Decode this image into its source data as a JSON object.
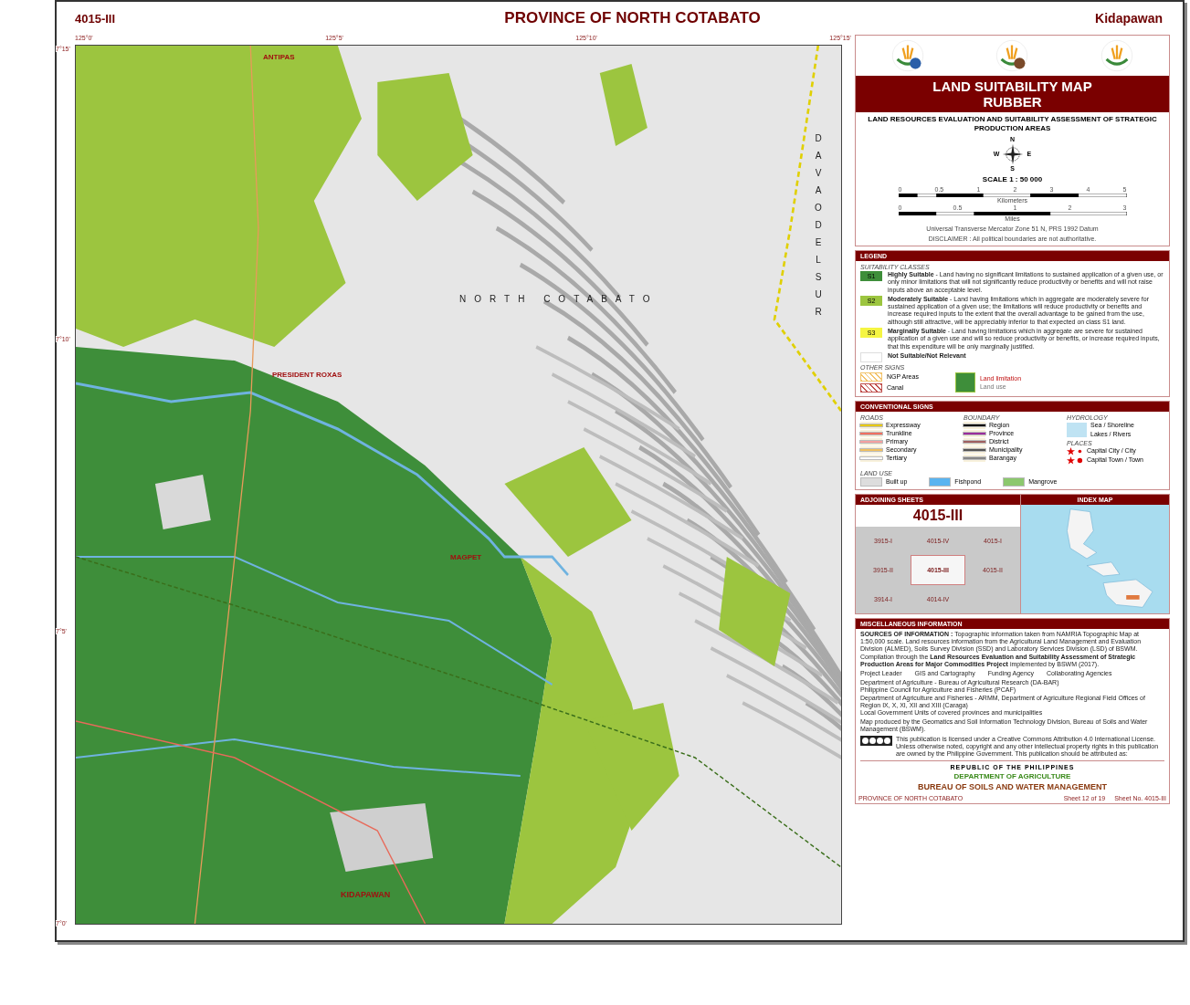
{
  "header": {
    "sheet": "4015-III",
    "title": "PROVINCE OF NORTH COTABATO",
    "place": "Kidapawan"
  },
  "map": {
    "top_ticks": [
      "125°0'",
      "125°5'",
      "125°10'",
      "125°15'"
    ],
    "left_ticks": [
      "7°15'",
      "7°10'",
      "7°5'",
      "7°0'"
    ],
    "labels": [
      {
        "text": "ANTIPAS",
        "kind": "town"
      },
      {
        "text": "PRESIDENT ROXAS",
        "kind": "town"
      },
      {
        "text": "MAGPET",
        "kind": "town"
      },
      {
        "text": "KIDAPAWAN",
        "kind": "city"
      },
      {
        "text": "NORTH COTABATO",
        "kind": "province"
      },
      {
        "text": "DAVAO DEL SUR",
        "kind": "vertical"
      }
    ]
  },
  "title_panel": {
    "title_lines": [
      "LAND SUITABILITY MAP",
      "RUBBER"
    ],
    "subtitle": "LAND RESOURCES EVALUATION AND SUITABILITY ASSESSMENT OF STRATEGIC PRODUCTION AREAS",
    "compass": {
      "n": "N",
      "e": "E",
      "s": "S",
      "w": "W"
    },
    "scale": "SCALE  1 : 50 000",
    "km_ticks": [
      "0",
      "0.5",
      "1",
      "2",
      "3",
      "4",
      "5"
    ],
    "km_unit": "Kilometers",
    "mi_ticks": [
      "0",
      "0.5",
      "1",
      "2",
      "3"
    ],
    "mi_unit": "Miles",
    "datum": "Universal Transverse Mercator Zone 51 N, PRS 1992 Datum",
    "disclaimer": "DISCLAIMER : All political boundaries are not authoritative."
  },
  "legend": {
    "heading": "LEGEND",
    "classes_heading": "SUITABILITY CLASSES",
    "classes": [
      {
        "code": "S1",
        "name": "Highly Suitable",
        "description": "- Land having no significant limitations to sustained application of a given use, or only minor limitations that will not significantly reduce productivity or benefits and will not raise inputs above an acceptable level.",
        "color": "#3e8e3a"
      },
      {
        "code": "S2",
        "name": "Moderately Suitable",
        "description": "- Land having limitations which in aggregate are moderately severe for sustained application of a given use; the limitations will reduce productivity or benefits and increase required inputs to the extent that the overall advantage to be gained from the use, although still attractive, will be appreciably inferior to that expected on class S1 land.",
        "color": "#9cc53f"
      },
      {
        "code": "S3",
        "name": "Marginally Suitable",
        "description": "- Land having limitations which in aggregate are severe for sustained application of a given use and will so reduce productivity or benefits, or increase required inputs, that this expenditure will be only marginally justified.",
        "color": "#f5f542"
      }
    ],
    "not_suitable": "Not Suitable/Not Relevant",
    "other_heading": "OTHER SIGNS",
    "other": [
      {
        "label": "NGP Areas",
        "color": "#f2c36b"
      },
      {
        "label": "Canal",
        "color": "#c0504d"
      }
    ],
    "limitation": "Land limitation",
    "land_use": "Land use"
  },
  "conventional_signs": {
    "heading": "CONVENTIONAL SIGNS",
    "roads_heading": "ROADS",
    "roads": [
      {
        "label": "Expressway",
        "color": "#e8c800"
      },
      {
        "label": "Trunkline",
        "color": "#f07060"
      },
      {
        "label": "Primary",
        "color": "#f4a0a0"
      },
      {
        "label": "Secondary",
        "color": "#f0c060"
      },
      {
        "label": "Tertiary",
        "color": "#ffffff"
      }
    ],
    "boundary_heading": "BOUNDARY",
    "boundaries": [
      {
        "label": "Region",
        "color": "#000000"
      },
      {
        "label": "Province",
        "color": "#9b2d9b"
      },
      {
        "label": "District",
        "color": "#a06060"
      },
      {
        "label": "Municipality",
        "color": "#555555"
      },
      {
        "label": "Barangay",
        "color": "#888888"
      }
    ],
    "hydrology_heading": "HYDROLOGY",
    "hydrology": [
      "Sea / Shoreline",
      "Lakes / Rivers"
    ],
    "places_heading": "PLACES",
    "places": [
      "Capital City / City",
      "Capital Town / Town"
    ],
    "land_use_heading": "LAND USE",
    "land_use": [
      {
        "label": "Built up",
        "color": "#dddddd"
      },
      {
        "label": "Fishpond",
        "color": "#5ab4f0"
      },
      {
        "label": "Mangrove",
        "color": "#8cc86e"
      }
    ]
  },
  "adjoining": {
    "heading": "ADJOINING SHEETS",
    "current": "4015-III",
    "index_heading": "INDEX MAP",
    "sheets": [
      {
        "label": "3915-I",
        "selected": false
      },
      {
        "label": "4015-IV",
        "selected": false
      },
      {
        "label": "4015-I",
        "selected": false
      },
      {
        "label": "3915-II",
        "selected": false
      },
      {
        "label": "4015-III",
        "selected": true
      },
      {
        "label": "4015-II",
        "selected": false
      },
      {
        "label": "3914-I",
        "selected": false
      },
      {
        "label": "4014-IV",
        "selected": false
      }
    ]
  },
  "misc": {
    "heading": "MISCELLANEOUS INFORMATION",
    "sources": "**SOURCES OF INFORMATION :** Topographic information taken from NAMRIA Topographic Map at 1:50,000 scale. Land resources information from the Agricultural Land Management and Evaluation Division (ALMED), Soils Survey Division (SSD) and Laboratory Services Division (LSD) of BSWM. Compilation through the **Land Resources Evaluation and Suitability Assessment of Strategic Production Areas for Major Commodities Project** implemented by BSWM (2017).",
    "roles": [
      "Project Leader",
      "GIS and Cartography",
      "Funding Agency",
      "Collaborating Agencies"
    ],
    "agencies": [
      "Department of Agriculture - Bureau of Agricultural Research (DA-BAR)",
      "Philippine Council for Agriculture and Fisheries (PCAF)",
      "Department of Agriculture and Fisheries - ARMM, Department of Agriculture Regional Field Offices of Region IX, X, XI, XII and XIII (Caraga)",
      "Local Government Units of covered provinces and municipalities"
    ],
    "produced": "Map produced by the Geomatics and Soil Information Technology Division, Bureau of Soils and Water Management (BSWM).",
    "license": "This publication is licensed under a Creative Commons Attribution 4.0 International License. Unless otherwise noted, copyright and any other intellectual property rights in this publication are owned by the Philippine Government. This publication should be attributed as:",
    "republic": "REPUBLIC OF THE PHILIPPINES",
    "department": "DEPARTMENT OF AGRICULTURE",
    "bureau": "BUREAU OF SOILS AND WATER MANAGEMENT"
  },
  "footer": {
    "province": "PROVINCE OF NORTH COTABATO",
    "sheet_count": "Sheet 12 of 19",
    "sheet_no": "Sheet No. 4015-III"
  }
}
